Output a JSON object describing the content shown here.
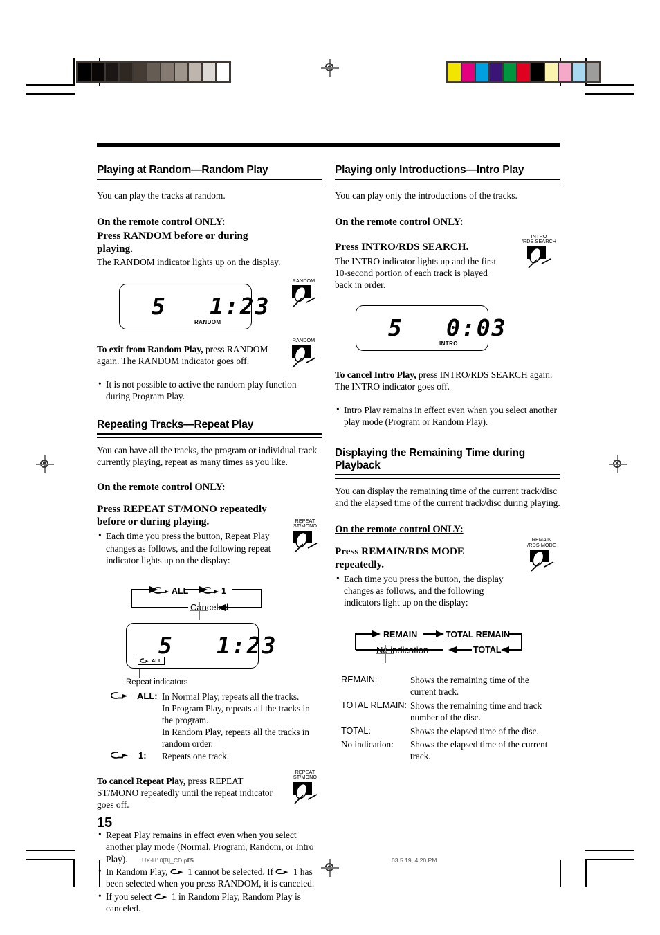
{
  "page": {
    "number": "15",
    "footer_file": "UX-H10[B]_CD.p65",
    "footer_page": "15",
    "footer_timestamp": "03.5.19, 4:20 PM"
  },
  "printmarks": {
    "gray_strip": [
      "#000000",
      "#0a0706",
      "#1c1714",
      "#2e2722",
      "#443c35",
      "#655c54",
      "#847a72",
      "#9e958d",
      "#bdb5ae",
      "#dcd8d3",
      "#ffffff"
    ],
    "color_strip": [
      "#f2e500",
      "#e2007f",
      "#00a0e0",
      "#3a1575",
      "#009640",
      "#e00020",
      "#000000",
      "#faf4ae",
      "#f5a9c8",
      "#a8d8f0",
      "#9d9d9c"
    ]
  },
  "sections": {
    "random": {
      "heading": "Playing at Random—Random Play",
      "intro": "You can play the tracks at random.",
      "remote_only": "On the remote control ONLY:",
      "instruction": "Press RANDOM before or during playing.",
      "instruction_detail": "The RANDOM indicator lights up on the display.",
      "key_label": "RANDOM",
      "display": {
        "track": "5",
        "time": "1:23",
        "indicator": "RANDOM"
      },
      "cancel_bold": "To exit from Random Play,",
      "cancel_rest": " press RANDOM again. The RANDOM indicator goes off.",
      "cancel_key_label": "RANDOM",
      "notes": [
        "It is not possible to active the random play function during Program Play."
      ]
    },
    "repeat": {
      "heading": "Repeating Tracks—Repeat Play",
      "intro": "You can have all the tracks, the program or individual track currently playing, repeat as many times as you like.",
      "remote_only": "On the remote control ONLY:",
      "instruction": "Press REPEAT ST/MONO repeatedly before or during playing.",
      "key_label": "REPEAT\nST/MONO",
      "bullet": "Each time you press the button, Repeat Play changes as follows, and the following repeat indicator lights up on the display:",
      "cycle": {
        "item1": "ALL",
        "item2": "1",
        "item3": "Canceled"
      },
      "display": {
        "track": "5",
        "time": "1:23",
        "indicator": "ALL"
      },
      "display_caption": "Repeat indicators",
      "legend": [
        {
          "symbol": "repeat-arrow",
          "term": "ALL:",
          "lines": [
            "In Normal Play, repeats all the tracks.",
            "In Program Play, repeats all the tracks in the program.",
            "In Random Play, repeats all the tracks in random order."
          ]
        },
        {
          "symbol": "repeat-arrow",
          "term": "1:",
          "lines": [
            "Repeats one track."
          ]
        }
      ],
      "cancel_bold": "To cancel Repeat Play,",
      "cancel_rest": " press REPEAT ST/MONO repeatedly until the repeat indicator goes off.",
      "cancel_key_label": "REPEAT\nST/MONO",
      "notes": [
        "Repeat Play remains in effect even when you select another play mode (Normal, Program, Random, or Intro Play).",
        "In Random Play, ↺ 1 cannot be selected. If ↺ 1 has been selected when you press RANDOM, it is canceled.",
        "If you select ↺ 1 in Random Play, Random Play is canceled."
      ],
      "note2_parts": {
        "a": "In Random Play,",
        "b": "1 cannot be selected. If",
        "c": "1 has been selected when you press RANDOM, it is canceled."
      },
      "note3_parts": {
        "a": "If you select",
        "b": "1 in Random Play, Random Play is canceled."
      }
    },
    "intro": {
      "heading": "Playing only Introductions—Intro Play",
      "intro": "You can play only the introductions of the tracks.",
      "remote_only": "On the remote control ONLY:",
      "instruction": "Press INTRO/RDS SEARCH.",
      "instruction_detail": "The INTRO indicator lights up and the first 10-second portion of each track is played back in order.",
      "key_label": "INTRO\n/RDS SEARCH",
      "display": {
        "track": "5",
        "time": "0:03",
        "indicator": "INTRO"
      },
      "cancel_bold": "To cancel Intro Play,",
      "cancel_rest": " press INTRO/RDS SEARCH again. The INTRO indicator goes off.",
      "notes": [
        "Intro Play remains in effect even when you select another play mode (Program or Random Play)."
      ]
    },
    "remain": {
      "heading": "Displaying the Remaining Time during Playback",
      "intro": "You can display the remaining time of the current track/disc and the elapsed time of the current track/disc during playing.",
      "remote_only": "On the remote control ONLY:",
      "instruction": "Press REMAIN/RDS MODE repeatedly.",
      "key_label": "REMAIN\n/RDS MODE",
      "bullet": "Each time you press the button, the display changes as follows, and the following indicators light up on the display:",
      "cycle": {
        "item1": "REMAIN",
        "item2": "TOTAL REMAIN",
        "item3": "TOTAL",
        "item4": "No indication"
      },
      "table": [
        {
          "term": "REMAIN:",
          "desc": "Shows the remaining time of the current track."
        },
        {
          "term": "TOTAL REMAIN:",
          "desc": "Shows the remaining time and track number of the disc."
        },
        {
          "term": "TOTAL:",
          "desc": "Shows the elapsed time of the disc."
        },
        {
          "term": "No indication:",
          "desc": "Shows the elapsed time of the current track."
        }
      ]
    }
  }
}
